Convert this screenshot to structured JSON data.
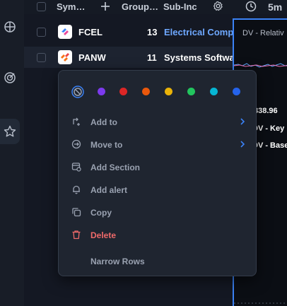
{
  "header": {
    "symbol_label": "Sym…",
    "group_label": "Group…",
    "subindustry_label": "Sub-Inc",
    "timeframe_label": "5m"
  },
  "rows": [
    {
      "symbol": "FCEL",
      "count": "13",
      "subindustry": "Electrical Compo",
      "subindustry_color": "#6ea8ff"
    },
    {
      "symbol": "PANW",
      "count": "11",
      "subindustry": "Systems Softwar",
      "subindustry_color": "#ffffff"
    }
  ],
  "chart": {
    "title": "DV - Relativ",
    "price": "338.96",
    "line1": "DV - Key",
    "line2": "DV - Base"
  },
  "menu": {
    "colors": [
      "#7c3aed",
      "#dc2626",
      "#ea580c",
      "#eab308",
      "#22c55e",
      "#06b6d4",
      "#2563eb"
    ],
    "items": [
      {
        "label": "Add to",
        "icon": "add-to-icon",
        "submenu": true
      },
      {
        "label": "Move to",
        "icon": "move-to-icon",
        "submenu": true
      },
      {
        "label": "Add Section",
        "icon": "add-section-icon",
        "submenu": false
      },
      {
        "label": "Add alert",
        "icon": "bell-icon",
        "submenu": false
      },
      {
        "label": "Copy",
        "icon": "copy-icon",
        "submenu": false
      },
      {
        "label": "Delete",
        "icon": "trash-icon",
        "submenu": false,
        "danger": true
      }
    ],
    "narrow_rows_label": "Narrow Rows"
  }
}
